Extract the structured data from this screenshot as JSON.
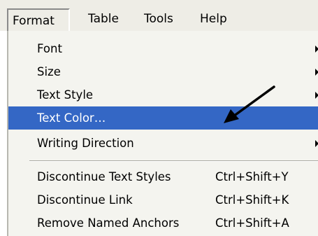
{
  "menubar": {
    "items": [
      {
        "label": "Format",
        "active": true
      },
      {
        "label": "Table"
      },
      {
        "label": "Tools"
      },
      {
        "label": "Help"
      }
    ]
  },
  "menu": {
    "items": [
      {
        "label": "Font",
        "submenu": true
      },
      {
        "label": "Size",
        "submenu": true
      },
      {
        "label": "Text Style",
        "submenu": true
      },
      {
        "label": "Text Color…",
        "highlighted": true
      },
      {
        "label": "Writing Direction",
        "submenu": true
      },
      {
        "label": "Discontinue Text Styles",
        "shortcut": "Ctrl+Shift+Y"
      },
      {
        "label": "Discontinue Link",
        "shortcut": "Ctrl+Shift+K"
      },
      {
        "label": "Remove Named Anchors",
        "shortcut": "Ctrl+Shift+A"
      }
    ]
  },
  "colors": {
    "highlight": "#3467c5",
    "menubar_bg": "#eeede6",
    "menu_bg": "#f4f4ef"
  },
  "annotation": {
    "icon": "pointer-arrow-icon"
  }
}
